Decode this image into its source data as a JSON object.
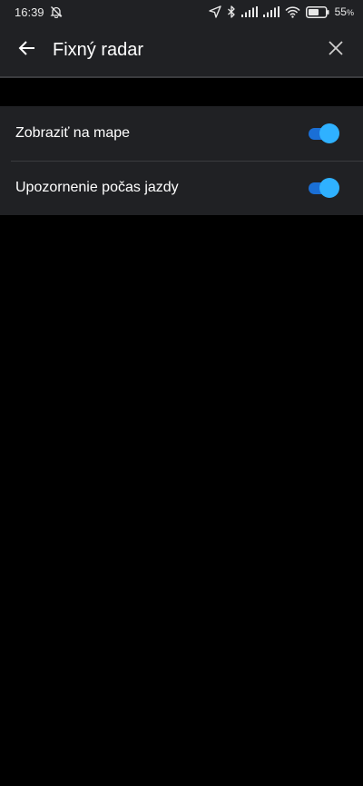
{
  "status_bar": {
    "time": "16:39",
    "battery": "55",
    "battery_unit": "%"
  },
  "app_bar": {
    "title": "Fixný radar"
  },
  "settings": [
    {
      "label": "Zobraziť na mape",
      "enabled": true
    },
    {
      "label": "Upozornenie počas jazdy",
      "enabled": true
    }
  ],
  "colors": {
    "surface": "#202124",
    "background": "#000000",
    "toggle_track": "#1a6fd6",
    "toggle_knob": "#2fb1ff",
    "divider": "#3a3b3e"
  }
}
